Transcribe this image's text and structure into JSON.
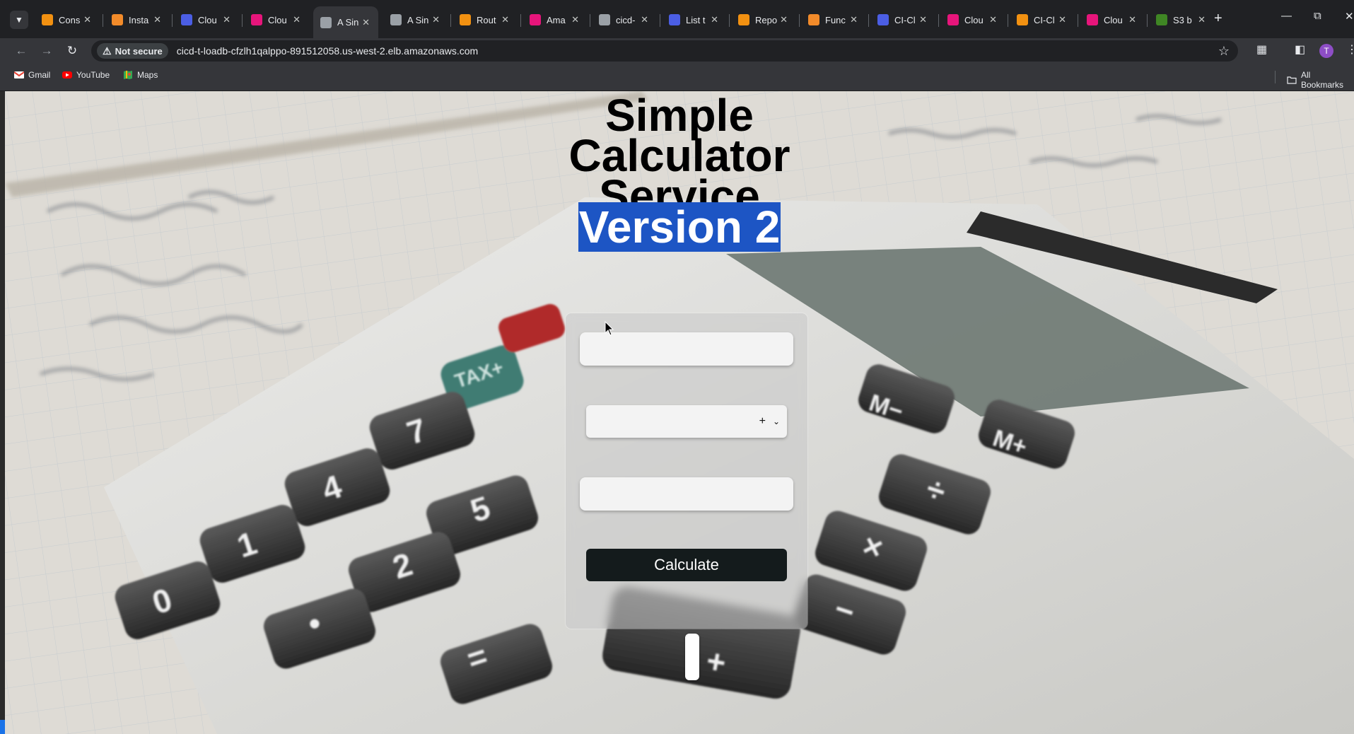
{
  "browser": {
    "tabs": [
      {
        "title": "Cons",
        "favicon_color": "#f29111"
      },
      {
        "title": "Insta",
        "favicon_color": "#f28b2a"
      },
      {
        "title": "Clou",
        "favicon_color": "#4b5ee4"
      },
      {
        "title": "Clou",
        "favicon_color": "#e7157b"
      },
      {
        "title": "A Sin",
        "favicon_color": "#9aa0a6",
        "active": true
      },
      {
        "title": "A Sin",
        "favicon_color": "#9aa0a6"
      },
      {
        "title": "Rout",
        "favicon_color": "#f29111"
      },
      {
        "title": "Ama",
        "favicon_color": "#e7157b"
      },
      {
        "title": "cicd-",
        "favicon_color": "#9aa0a6"
      },
      {
        "title": "List t",
        "favicon_color": "#4b5ee4"
      },
      {
        "title": "Repo",
        "favicon_color": "#f29111"
      },
      {
        "title": "Func",
        "favicon_color": "#f28b2a"
      },
      {
        "title": "CI-Cl",
        "favicon_color": "#4b5ee4"
      },
      {
        "title": "Clou",
        "favicon_color": "#e7157b"
      },
      {
        "title": "CI-Cl",
        "favicon_color": "#f29111"
      },
      {
        "title": "Clou",
        "favicon_color": "#e7157b"
      },
      {
        "title": "S3 b",
        "favicon_color": "#3f8624"
      }
    ],
    "security_chip": "Not secure",
    "url": "cicd-t-loadb-cfzlh1qalppo-891512058.us-west-2.elb.amazonaws.com",
    "avatar_letter": "T",
    "bookmarks": [
      "Gmail",
      "YouTube",
      "Maps"
    ],
    "all_bookmarks": "All Bookmarks"
  },
  "page": {
    "title_lines": [
      "Simple",
      "Calculator",
      "Service"
    ],
    "version_label": "Version 2",
    "form": {
      "first_number_value": "",
      "operator_selected": "+",
      "second_number_value": "",
      "calculate_label": "Calculate"
    }
  }
}
